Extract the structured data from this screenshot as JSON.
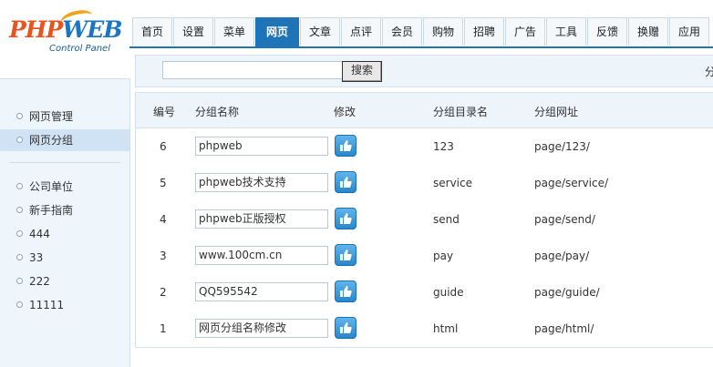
{
  "logo": {
    "php": "PHP",
    "web": "WEB",
    "sub": "Control Panel"
  },
  "tabs": [
    "首页",
    "设置",
    "菜单",
    "网页",
    "文章",
    "点评",
    "会员",
    "购物",
    "招聘",
    "广告",
    "工具",
    "反馈",
    "换赠",
    "应用"
  ],
  "active_tab": "网页",
  "sidebar": {
    "group1": [
      "网页管理",
      "网页分组"
    ],
    "active": "网页分组",
    "group2": [
      "公司单位",
      "新手指南",
      "444",
      "33",
      "222",
      "11111"
    ]
  },
  "toolbar": {
    "search_value": "",
    "search_label": "搜索",
    "cutoff_text": "分"
  },
  "table": {
    "headers": {
      "num": "编号",
      "name": "分组名称",
      "edit": "修改",
      "dir": "分组目录名",
      "url": "分组网址"
    },
    "rows": [
      {
        "num": "6",
        "name": "phpweb",
        "dir": "123",
        "url": "page/123/"
      },
      {
        "num": "5",
        "name": "phpweb技术支持",
        "dir": "service",
        "url": "page/service/"
      },
      {
        "num": "4",
        "name": "phpweb正版授权",
        "dir": "send",
        "url": "page/send/"
      },
      {
        "num": "3",
        "name": "www.100cm.cn",
        "dir": "pay",
        "url": "page/pay/"
      },
      {
        "num": "2",
        "name": "QQ595542",
        "dir": "guide",
        "url": "page/guide/"
      },
      {
        "num": "1",
        "name": "网页分组名称修改",
        "dir": "html",
        "url": "page/html/"
      }
    ]
  },
  "colors": {
    "accent": "#1f74b8",
    "logo_orange": "#e8531f",
    "logo_blue": "#1a76c2"
  }
}
